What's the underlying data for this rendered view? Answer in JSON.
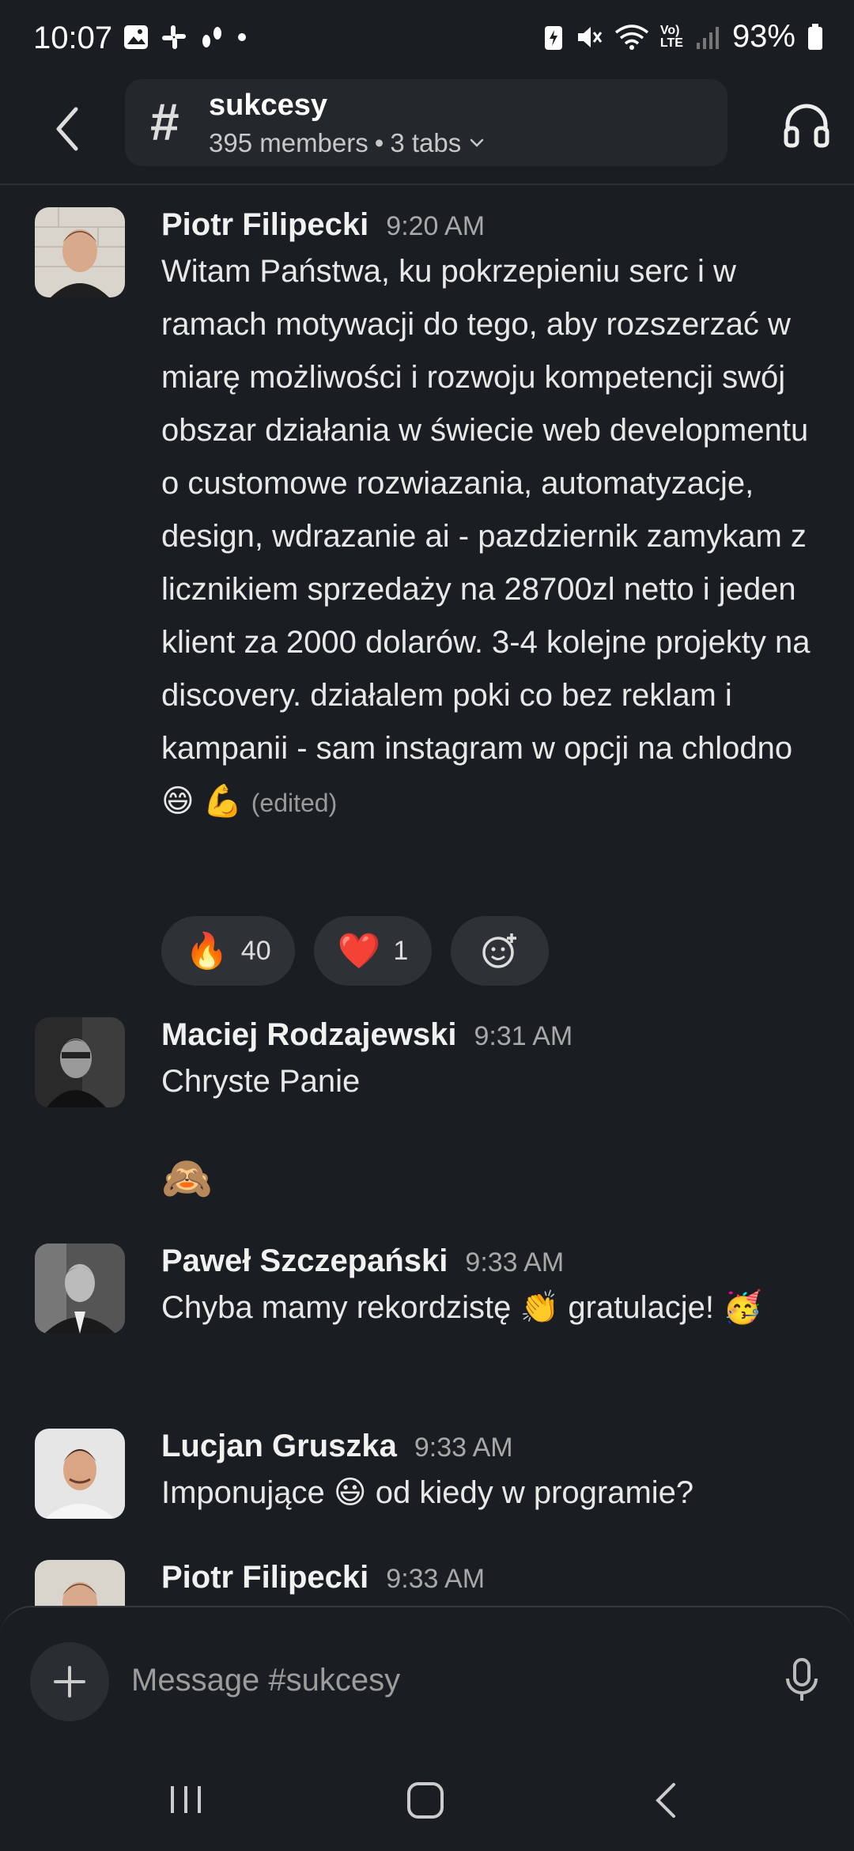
{
  "status_bar": {
    "time": "10:07",
    "battery": "93%",
    "lte_label": "LTE",
    "volte_label": "Vo)"
  },
  "header": {
    "channel_name": "sukcesy",
    "members": "395 members",
    "tabs": "3 tabs"
  },
  "messages": [
    {
      "author": "Piotr Filipecki",
      "time": "9:20 AM",
      "text": "Witam Państwa, ku pokrzepieniu serc i w ramach motywacji do tego, aby rozszerzać w miarę możliwości i rozwoju kompetencji swój obszar działania w świecie web developmentu o customowe rozwiazania, automatyzacje, design, wdrazanie ai - pazdziernik zamykam z licznikiem sprzedaży na 28700zl netto i jeden klient za 2000 dolarów. 3-4 kolejne projekty na discovery. działalem poki co bez reklam i kampanii - sam instagram w opcji na chlodno 😄 💪",
      "edited": "(edited)",
      "reactions": [
        {
          "emoji": "🔥",
          "count": "40"
        },
        {
          "emoji": "❤️",
          "count": "1"
        }
      ]
    },
    {
      "author": "Maciej Rodzajewski",
      "time": "9:31 AM",
      "text": "Chryste Panie",
      "extra": "🙈"
    },
    {
      "author": "Paweł Szczepański",
      "time": "9:33 AM",
      "text": "Chyba mamy rekordzistę 👏  gratulacje! 🥳"
    },
    {
      "author": "Lucjan Gruszka",
      "time": "9:33 AM",
      "text": "Imponujące 😃 od kiedy w programie?"
    },
    {
      "author": "Piotr Filipecki",
      "time": "9:33 AM"
    }
  ],
  "composer": {
    "placeholder": "Message #sukcesy"
  },
  "icons": {
    "accent": "#2e3136",
    "background": "#1a1d21"
  }
}
